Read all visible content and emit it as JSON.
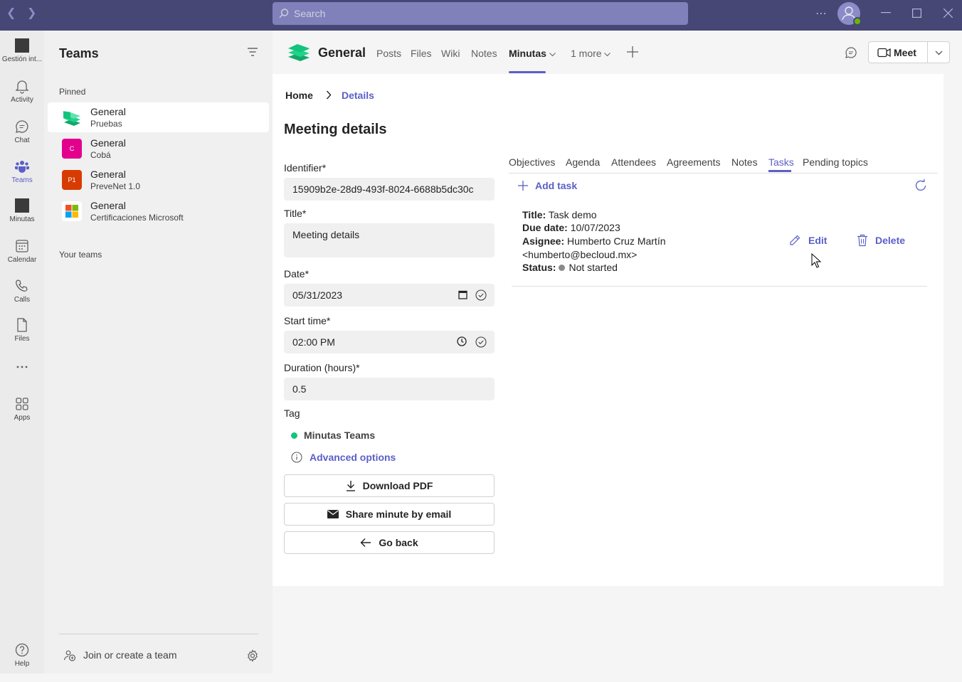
{
  "window": {
    "search_placeholder": "Search"
  },
  "rail": [
    {
      "id": "gestion",
      "label": "Gestión int..."
    },
    {
      "id": "activity",
      "label": "Activity"
    },
    {
      "id": "chat",
      "label": "Chat"
    },
    {
      "id": "teams",
      "label": "Teams"
    },
    {
      "id": "minutas",
      "label": "Minutas"
    },
    {
      "id": "calendar",
      "label": "Calendar"
    },
    {
      "id": "calls",
      "label": "Calls"
    },
    {
      "id": "files",
      "label": "Files"
    },
    {
      "id": "apps",
      "label": "Apps"
    },
    {
      "id": "help",
      "label": "Help"
    }
  ],
  "sidebar": {
    "title": "Teams",
    "pinned_label": "Pinned",
    "your_teams_label": "Your teams",
    "teams": [
      {
        "channel": "General",
        "team": "Pruebas"
      },
      {
        "channel": "General",
        "team": "Cobá",
        "logo_letter": "C"
      },
      {
        "channel": "General",
        "team": "PreveNet 1.0",
        "logo_letter": "P1"
      },
      {
        "channel": "General",
        "team": "Certificaciones Microsoft"
      }
    ],
    "join_label": "Join or create a team"
  },
  "header": {
    "channel": "General",
    "tabs": [
      "Posts",
      "Files",
      "Wiki",
      "Notes",
      "Minutas",
      "1 more"
    ],
    "meet_label": "Meet"
  },
  "content": {
    "breadcrumb_home": "Home",
    "breadcrumb_current": "Details",
    "page_title": "Meeting details",
    "identifier_label": "Identifier*",
    "identifier_value": "15909b2e-28d9-493f-8024-6688b5dc30c",
    "title_label": "Title*",
    "title_value": "Meeting details",
    "date_label": "Date*",
    "date_value": "05/31/2023",
    "start_label": "Start time*",
    "start_value": "02:00 PM",
    "duration_label": "Duration (hours)*",
    "duration_value": "0.5",
    "tag_label": "Tag",
    "tag_value": "Minutas Teams",
    "advanced_label": "Advanced options",
    "download_label": "Download PDF",
    "share_label": "Share minute by email",
    "back_label": "Go back",
    "inner_tabs": [
      "Objectives",
      "Agenda",
      "Attendees",
      "Agreements",
      "Notes",
      "Tasks",
      "Pending topics"
    ],
    "add_task_label": "Add task",
    "task": {
      "title_key": "Title:",
      "title_val": "Task demo",
      "due_key": "Due date:",
      "due_val": "10/07/2023",
      "assignee_key": "Asignee:",
      "assignee_val": "Humberto Cruz Martín",
      "assignee_email": "<humberto@becloud.mx>",
      "status_key": "Status:",
      "status_val": "Not started",
      "edit_label": "Edit",
      "delete_label": "Delete"
    }
  },
  "colors": {
    "accent": "#5b5fc7",
    "titlebar": "#464775",
    "tag_dot": "#13c47c"
  }
}
